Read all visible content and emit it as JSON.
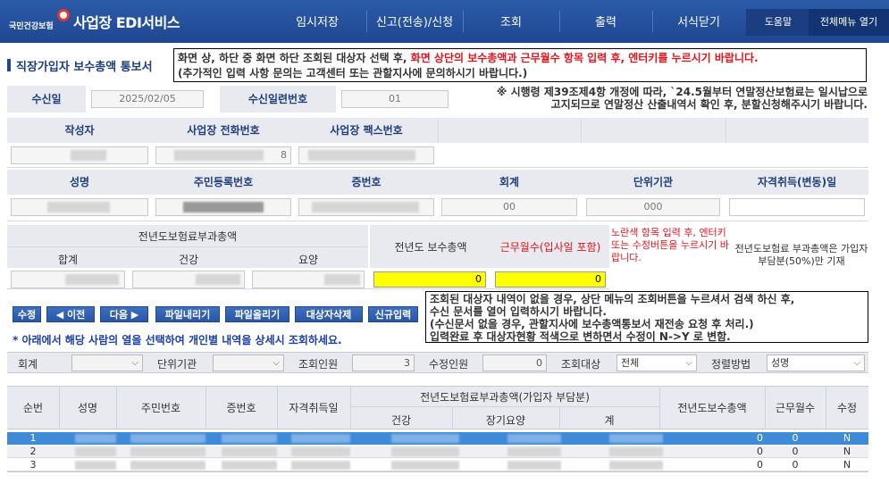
{
  "header": {
    "logo_text": "국민건강보험",
    "title": "사업장 EDI서비스",
    "menu": [
      "임시저장",
      "신고(전송)/신청",
      "조회",
      "출력",
      "서식닫기"
    ],
    "help": "도움말",
    "all_menu": "전체메뉴 열기"
  },
  "page": {
    "title": "직장가입자 보수총액 통보서",
    "notice_line1_a": "화면 상, 하단 중 화면 하단 조회된 대상자 선택 후, ",
    "notice_line1_b": "화면 상단의 보수총액과 근무월수 항목 입력 후, 엔터키를 누르시기 바랍니다.",
    "notice_line2": "(추가적인 입력 사항 문의는 고객센터 또는 관할지사에 문의하시기 바랍니다.)"
  },
  "receipt": {
    "date_label": "수신일",
    "date_value": "2025/02/05",
    "serial_label": "수신일련번호",
    "serial_value": "01",
    "notice_line1": "※ 시행령 제39조제4항 개정에 따라, `24.5월부터 연말정산보험료는 일시납으로",
    "notice_line2": "고지되므로 연말정산 산출내역서 확인 후, 분할신청해주시기 바랍니다."
  },
  "writer": {
    "writer_label": "작성자",
    "phone_label": "사업장 전화번호",
    "fax_label": "사업장 팩스번호",
    "phone_suffix": "8"
  },
  "person": {
    "name_label": "성명",
    "rrn_label": "주민등록번호",
    "card_label": "증번호",
    "account_label": "회계",
    "unit_label": "단위기관",
    "qual_label": "자격취득(변동)일",
    "account_value": "00",
    "unit_value": "000"
  },
  "premium": {
    "group_label": "전년도보험료부과총액",
    "total_label": "합계",
    "health_label": "건강",
    "care_label": "요양",
    "prev_salary_label": "전년도 보수총액",
    "months_label": "근무월수(입사일 포함)",
    "yellow_note": "노란색 항목 입력 후, 엔터키 또는 수정버튼을 누르시기 바랍니다.",
    "side_note": "전년도보험료 부과총액은 가입자부담분(50%)만 기재",
    "prev_salary_value": "0",
    "months_value": "0"
  },
  "buttons": {
    "edit": "수정",
    "prev": "◀ 이전",
    "next": "다음 ▶",
    "download": "파일내리기",
    "upload": "파일올리기",
    "delete": "대상자삭제",
    "new": "신규입력"
  },
  "hint": "* 아래에서 해당 사람의 열을 선택하여 개인별 내역을 상세시 조회하세요.",
  "notice3": {
    "line1": "조회된 대상자 내역이 없을 경우, 상단 메뉴의 조회버튼을 누르셔서 검색 하신 후,",
    "line2": "수신 문서를 열어 입력하시기 바랍니다.",
    "line3": "(수신문서 없을 경우, 관할지사에 보수총액통보서 재전송 요청 후 처리.)",
    "line4": "입력완료 후 대상자현황 적색으로 변하면서 수정이 N->Y 로 변함."
  },
  "filter": {
    "account_label": "회계",
    "unit_label": "단위기관",
    "count_label": "조회인원",
    "count_value": "3",
    "edit_count_label": "수정인원",
    "edit_count_value": "0",
    "target_label": "조회대상",
    "target_value": "전체",
    "sort_label": "정렬방법",
    "sort_value": "성명"
  },
  "grid": {
    "headers": {
      "seq": "순번",
      "name": "성명",
      "rrn": "주민번호",
      "card": "증번호",
      "qual": "자격취득일",
      "group": "전년도보험료부과총액(가입자 부담분)",
      "health": "건강",
      "care": "장기요양",
      "sum": "계",
      "salary": "전년도보수총액",
      "months": "근무월수",
      "edit": "수정"
    },
    "rows": [
      {
        "seq": "1",
        "salary": "0",
        "months": "0",
        "edit": "N"
      },
      {
        "seq": "2",
        "salary": "0",
        "months": "0",
        "edit": "N"
      },
      {
        "seq": "3",
        "salary": "0",
        "months": "0",
        "edit": "N"
      }
    ]
  },
  "colors": {
    "header_blue": "#1f4791",
    "label_bg": "#e8eaef",
    "selected_row": "#3f8bd8",
    "notice_red": "#e3141b",
    "input_yellow": "#ffff00"
  }
}
